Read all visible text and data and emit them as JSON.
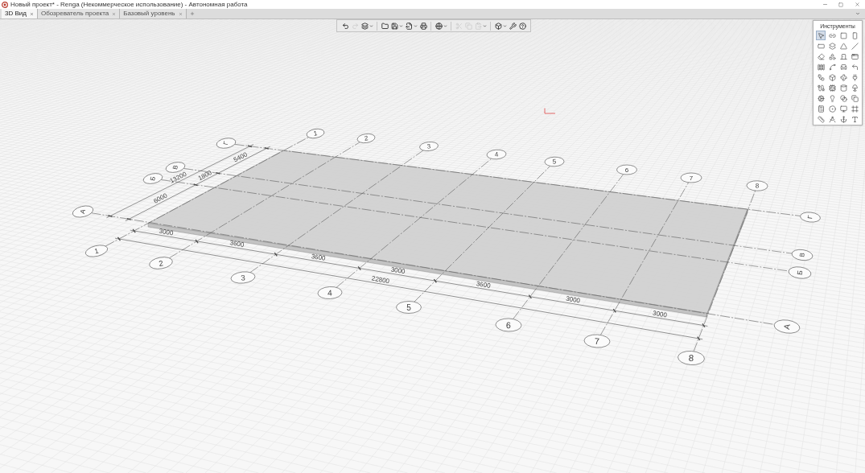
{
  "window": {
    "title": "Новый проект* - Renga (Некоммерческое использование) - Автономная работа"
  },
  "tabs": [
    {
      "label": "3D Вид",
      "selected": true
    },
    {
      "label": "Обозреватель проекта",
      "selected": false
    },
    {
      "label": "Базовый уровень",
      "selected": false
    }
  ],
  "toolbar": [
    [
      {
        "disabled": false
      },
      {
        "disabled": true
      },
      {
        "disabled": false
      }
    ],
    [
      {
        "disabled": false
      },
      {
        "disabled": false
      },
      {
        "disabled": false
      },
      {
        "disabled": false
      }
    ],
    [
      {
        "disabled": false
      }
    ],
    [
      {
        "disabled": true
      },
      {
        "disabled": true
      },
      {
        "disabled": true
      }
    ],
    [
      {
        "disabled": false
      },
      {
        "disabled": false
      },
      {
        "disabled": false
      }
    ]
  ],
  "tools": {
    "title": "Инструменты",
    "items": [
      {
        "selected": true
      },
      {
        "selected": false
      },
      {
        "selected": false
      },
      {
        "selected": false
      },
      {
        "selected": false
      },
      {
        "selected": false
      },
      {
        "selected": false
      },
      {
        "selected": false
      },
      {
        "selected": false
      },
      {
        "selected": false
      },
      {
        "selected": false
      },
      {
        "selected": false
      },
      {
        "selected": false
      },
      {
        "selected": false
      },
      {
        "selected": false
      },
      {
        "selected": false
      },
      {
        "selected": false
      },
      {
        "selected": false
      },
      {
        "selected": false
      },
      {
        "selected": false
      },
      {
        "selected": false
      },
      {
        "selected": false
      },
      {
        "selected": false
      },
      {
        "selected": false
      },
      {
        "selected": false
      },
      {
        "selected": false
      },
      {
        "selected": false
      },
      {
        "selected": false
      },
      {
        "selected": false
      },
      {
        "selected": false
      },
      {
        "selected": false
      },
      {
        "selected": false
      },
      {
        "selected": false
      },
      {
        "selected": false
      },
      {
        "selected": false
      },
      {
        "selected": false
      }
    ]
  },
  "grid_axes": {
    "numbered": [
      {
        "bottom_label": "1",
        "top_label": "1"
      },
      {
        "bottom_label": "2",
        "top_label": "2"
      },
      {
        "bottom_label": "3",
        "top_label": "3"
      },
      {
        "bottom_label": "4",
        "top_label": "4"
      },
      {
        "bottom_label": "5",
        "top_label": "5"
      },
      {
        "bottom_label": "6",
        "top_label": "6"
      },
      {
        "bottom_label": "7",
        "top_label": "7"
      },
      {
        "bottom_label": "8",
        "top_label": "8"
      }
    ],
    "lettered": [
      {
        "left_label": "А",
        "right_label": "А"
      },
      {
        "left_label": "Б",
        "right_label": "Б"
      },
      {
        "left_label": "В",
        "right_label": "В"
      },
      {
        "left_label": "Г",
        "right_label": "Г"
      }
    ]
  },
  "dimensions": {
    "bottom": {
      "segments": [
        "3000",
        "3600",
        "3600",
        "3000",
        "3600",
        "3000",
        "3000"
      ],
      "total": "22800"
    },
    "left": {
      "segments": [
        "6000",
        "1800",
        "5400"
      ],
      "total": "13200"
    }
  }
}
